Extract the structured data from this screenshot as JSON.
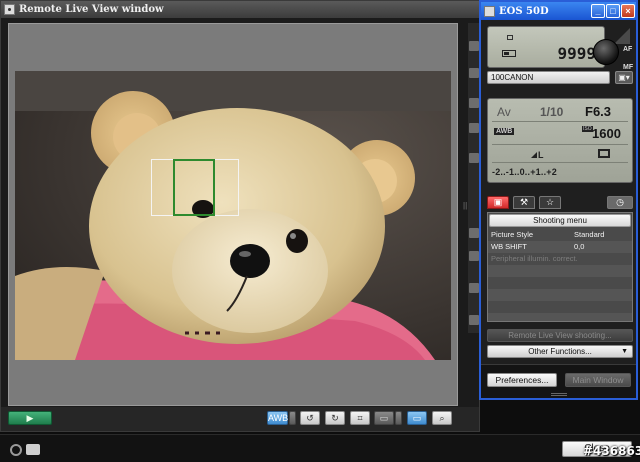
{
  "live_view": {
    "title": "Remote Live View window",
    "play_label": "▶",
    "toolbar": {
      "wb_label": "AWB",
      "rotate_left": "↺",
      "rotate_right": "↻",
      "grid": "⌗",
      "aspect": "▭",
      "zoom_fit": "▭",
      "zoom": "⌕"
    }
  },
  "status": {
    "close_label": "Close",
    "watermark": "#436863"
  },
  "eos": {
    "title": "EOS 50D",
    "window_buttons": {
      "minimize": "_",
      "maximize": "□",
      "close": "×"
    },
    "shots_remaining": "9999",
    "af_label": "AF",
    "mf_label": "MF",
    "folder": "100CANON",
    "camera_settings_icon": "▣▾",
    "shooting_mode": "Av",
    "shutter": "1/10",
    "aperture": "F6.3",
    "white_balance": "AWB",
    "iso_label": "ISO",
    "iso": "1600",
    "quality": "L",
    "exposure_scale": "-2..-1..0..+1..+2",
    "tabs": {
      "shooting": "▣",
      "tools": "⚒",
      "star": "☆",
      "timer": "◷"
    },
    "menu": {
      "header": "Shooting menu",
      "rows": [
        {
          "label": "Picture Style",
          "value": "Standard"
        },
        {
          "label": "WB SHIFT",
          "value": "0,0"
        },
        {
          "label": "Peripheral illumin. correct.",
          "value": ""
        }
      ]
    },
    "remote_live_view_shooting": "Remote Live View shooting...",
    "other_functions": "Other Functions...",
    "other_caret": "▼",
    "preferences": "Preferences...",
    "main_window": "Main Window"
  }
}
